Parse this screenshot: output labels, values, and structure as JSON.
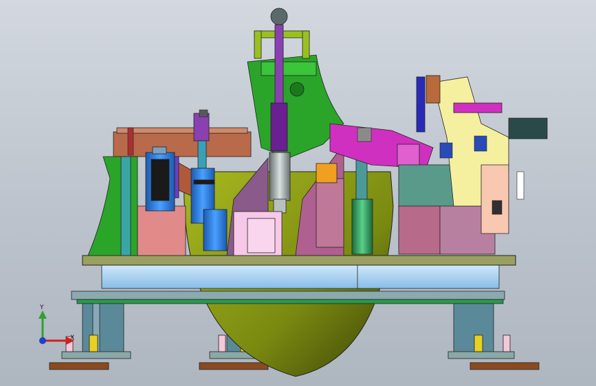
{
  "viewport": {
    "background_top": "#d3d8df",
    "background_bottom": "#aeb6c0"
  },
  "triad": {
    "y_label": "Y",
    "x_label": "X",
    "y_color": "#2fa02f",
    "x_color": "#d02020",
    "z_color": "#2040d0"
  },
  "colors": {
    "base_plate": "#a8d4f4",
    "green_body": "#2aa52a",
    "olive_dome": "#8a9a18",
    "salmon": "#e08a8a",
    "purple": "#8a40b0",
    "magenta": "#d030c0",
    "teal": "#3a8a8a",
    "yellow": "#f4f0a0",
    "blue_cylinder": "#3080e0",
    "pink_block": "#f8c8e8",
    "brown": "#a05a3a",
    "rust": "#b86040"
  }
}
